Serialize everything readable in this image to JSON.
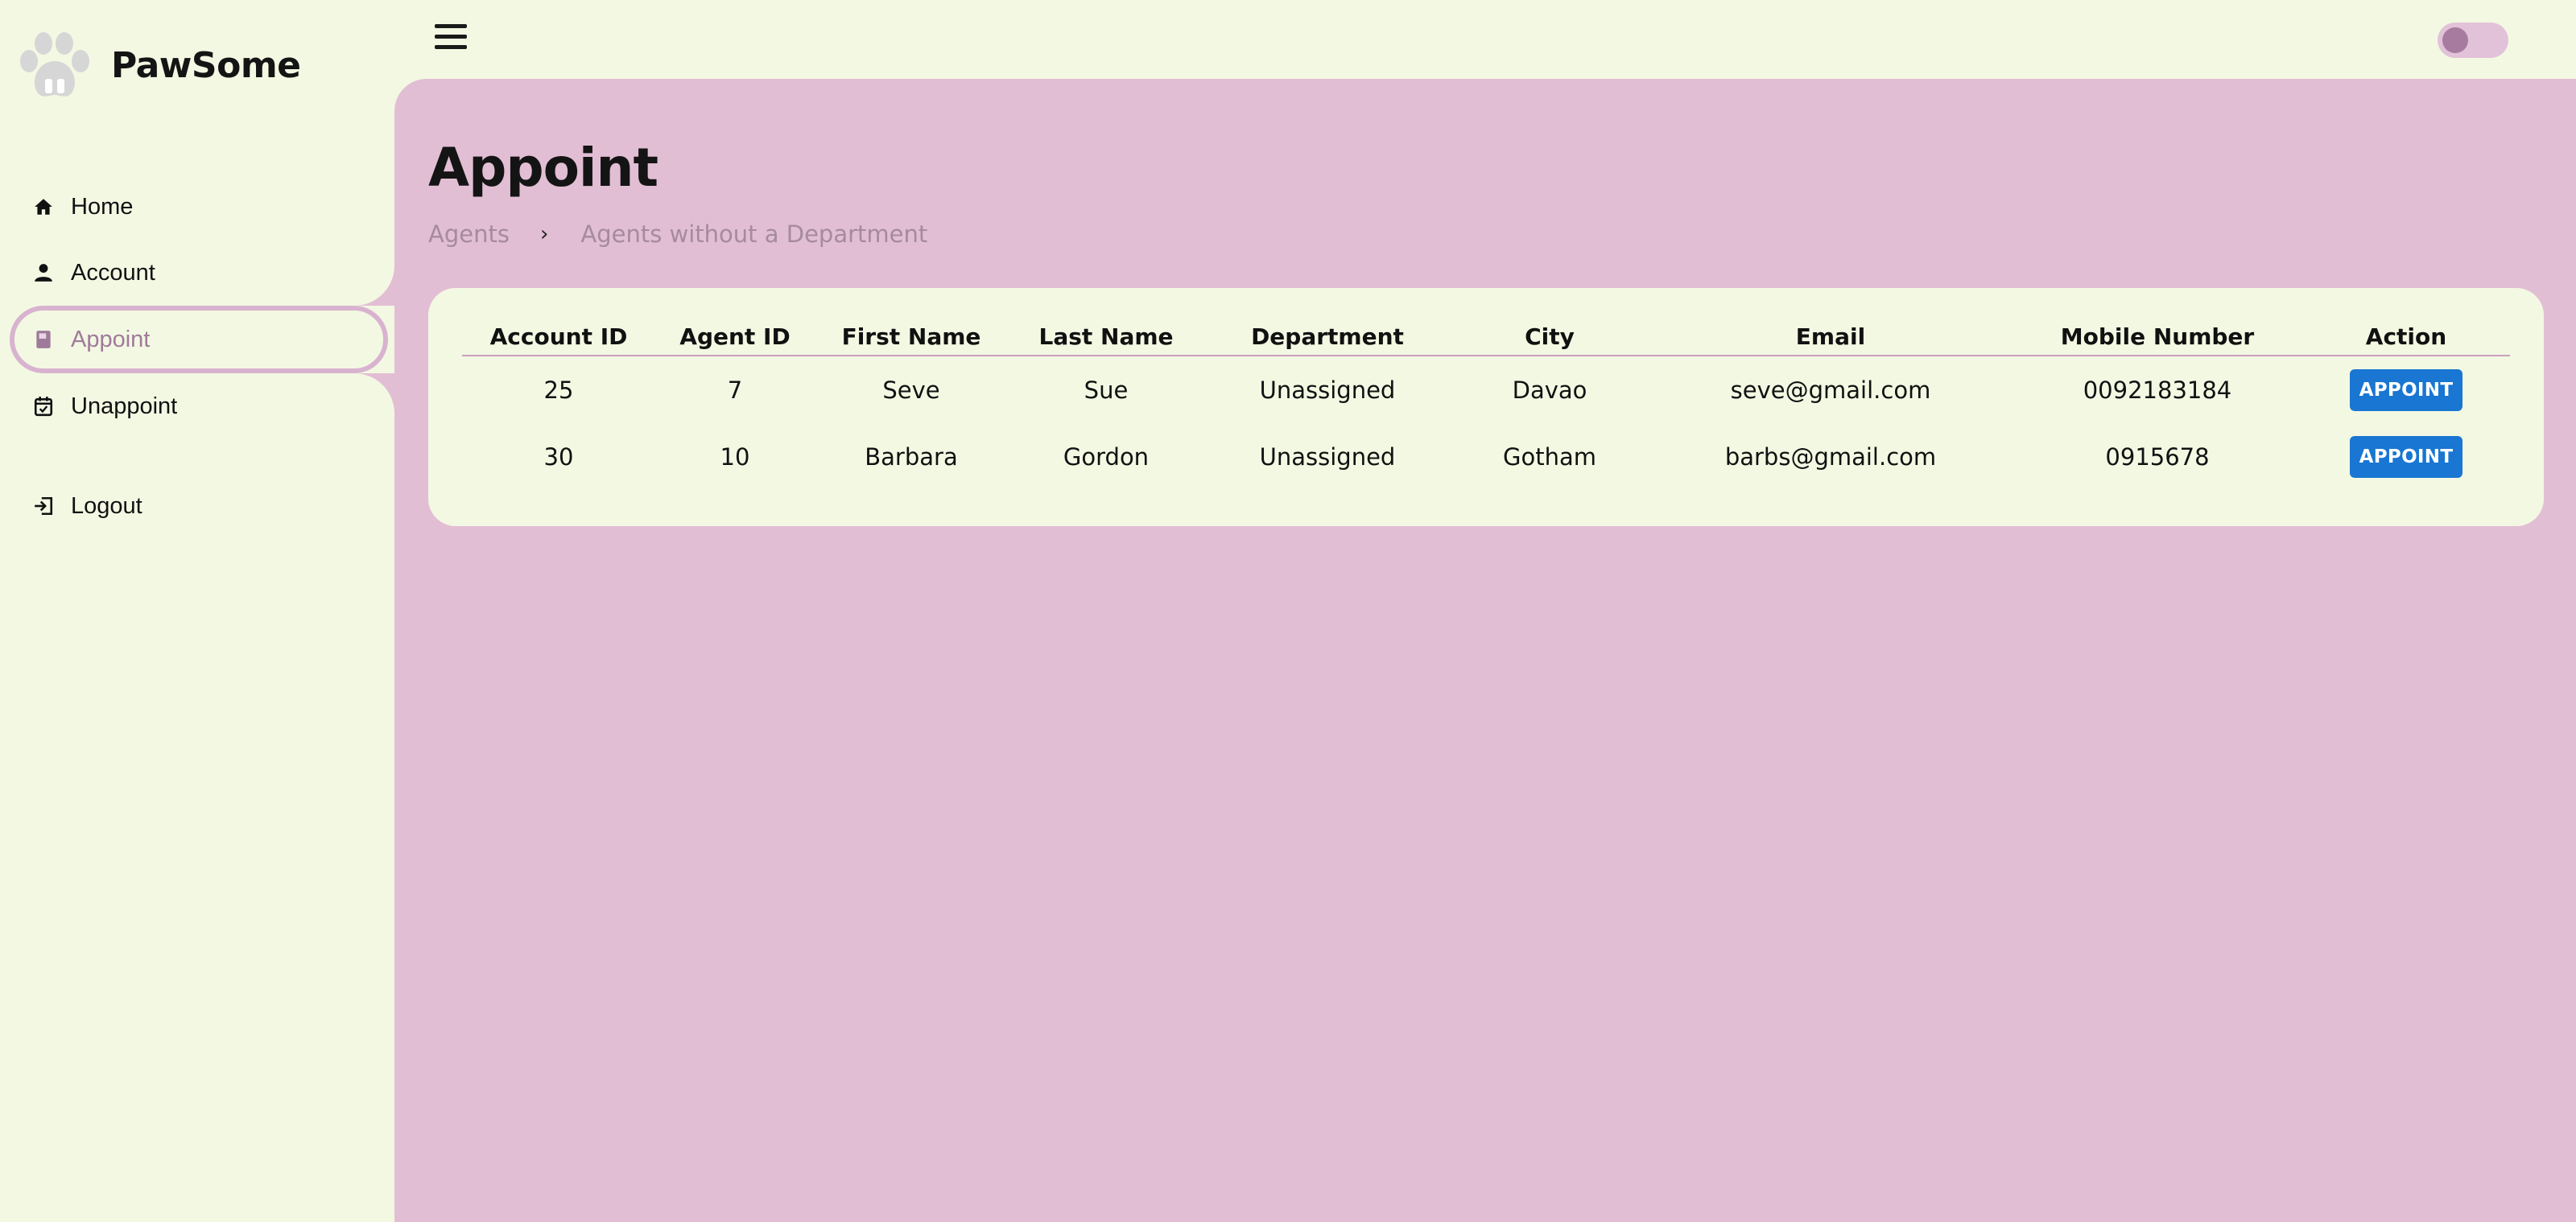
{
  "brand": {
    "name": "PawSome",
    "logo_icon": "paw-icon"
  },
  "sidebar": {
    "items": [
      {
        "label": "Home",
        "icon": "home-icon",
        "active": false
      },
      {
        "label": "Account",
        "icon": "person-icon",
        "active": false
      },
      {
        "label": "Appoint",
        "icon": "book-icon",
        "active": true
      },
      {
        "label": "Unappoint",
        "icon": "calendar-icon",
        "active": false
      }
    ],
    "logout": {
      "label": "Logout",
      "icon": "logout-icon"
    }
  },
  "topbar": {
    "menu_icon": "hamburger-icon",
    "theme_toggle": "toggle-switch"
  },
  "page": {
    "title": "Appoint",
    "breadcrumb": [
      "Agents",
      "Agents without a Department"
    ]
  },
  "table": {
    "columns": [
      "Account ID",
      "Agent ID",
      "First Name",
      "Last Name",
      "Department",
      "City",
      "Email",
      "Mobile Number",
      "Action"
    ],
    "rows": [
      {
        "account_id": "25",
        "agent_id": "7",
        "first_name": "Seve",
        "last_name": "Sue",
        "department": "Unassigned",
        "city": "Davao",
        "email": "seve@gmail.com",
        "mobile": "0092183184",
        "action": "APPOINT"
      },
      {
        "account_id": "30",
        "agent_id": "10",
        "first_name": "Barbara",
        "last_name": "Gordon",
        "department": "Unassigned",
        "city": "Gotham",
        "email": "barbs@gmail.com",
        "mobile": "0915678",
        "action": "APPOINT"
      }
    ]
  },
  "colors": {
    "sidebar_bg": "#f3f8e3",
    "main_bg": "#e2bed4",
    "accent": "#a67b9f",
    "button": "#1976d2"
  }
}
